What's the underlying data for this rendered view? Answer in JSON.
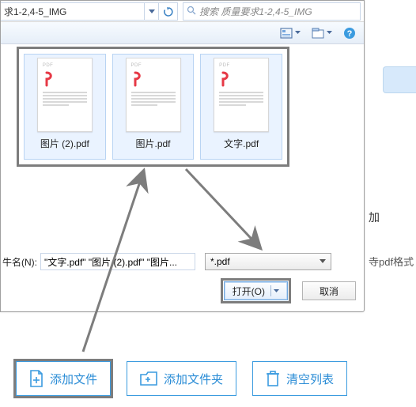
{
  "addressbar": {
    "path": "求1-2,4-5_IMG"
  },
  "search": {
    "placeholder": "搜索 质量要求1-2,4-5_IMG"
  },
  "files": [
    {
      "name": "图片 (2).pdf",
      "tag": "PDF"
    },
    {
      "name": "图片.pdf",
      "tag": "PDF"
    },
    {
      "name": "文字.pdf",
      "tag": "PDF"
    }
  ],
  "filename": {
    "label": "牛名(N):",
    "value": "\"文字.pdf\" \"图片 (2).pdf\" \"图片..."
  },
  "filter": {
    "value": "*.pdf"
  },
  "buttons": {
    "open": "打开(O)",
    "cancel": "取消"
  },
  "rightside": {
    "text1": "加",
    "text2": "寺pdf格式"
  },
  "actions": {
    "add_file": "添加文件",
    "add_folder": "添加文件夹",
    "clear": "清空列表"
  }
}
